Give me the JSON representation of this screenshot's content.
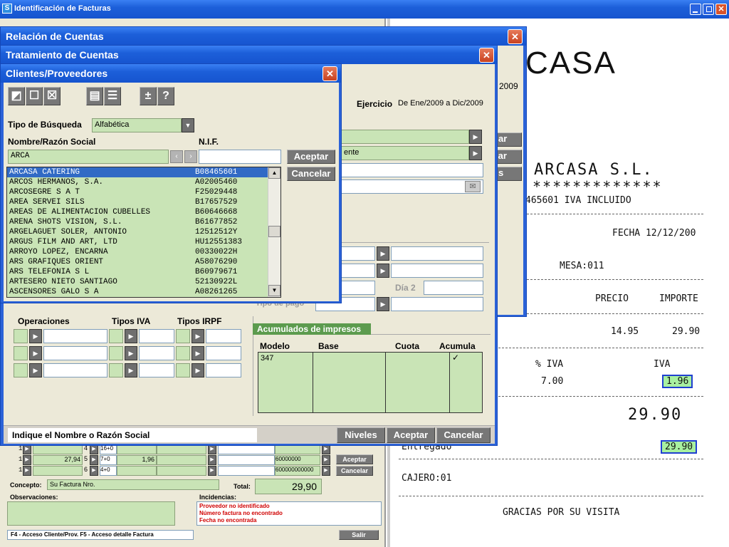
{
  "app": {
    "title": "Identificación de Facturas",
    "icon_letter": "S"
  },
  "dialogs": {
    "relacion": {
      "title": "Relación de Cuentas",
      "btn1": "ar",
      "btn2": "lar",
      "btn3": "s",
      "date_frag": "2009"
    },
    "tratamiento": {
      "title": "Tratamiento de Cuentas",
      "ejercicio_label": "Ejercicio",
      "ejercicio_value": "De Ene/2009 a Dic/2009",
      "field_frag": "ente",
      "dia2_label": "Día 2",
      "tipo_pago_label": "Tipo de pago",
      "operaciones": "Operaciones",
      "tipos_iva": "Tipos IVA",
      "tipos_irpf": "Tipos IRPF",
      "acumulados_tab": "Acumulados de impresos",
      "acum_headers": [
        "Modelo",
        "Base",
        "Cuota",
        "Acumula"
      ],
      "acum_row": {
        "modelo": "347",
        "base": "",
        "cuota": "",
        "acumula": "✓"
      },
      "status": "Indique el Nombre o Razón Social",
      "niveles": "Niveles",
      "aceptar": "Aceptar",
      "cancelar": "Cancelar"
    },
    "clientes": {
      "title": "Clientes/Proveedores",
      "tipo_busqueda_label": "Tipo de Búsqueda",
      "tipo_busqueda_value": "Alfabética",
      "nombre_label": "Nombre/Razón Social",
      "nif_label": "N.I.F.",
      "search_value": "ARCA",
      "aceptar": "Aceptar",
      "cancelar": "Cancelar",
      "items": [
        {
          "name": "ARCASA CATERING",
          "nif": "B08465601"
        },
        {
          "name": "ARCOS HERMANOS, S.A.",
          "nif": "A02005460"
        },
        {
          "name": "ARCOSEGRE S A T",
          "nif": "F25029448"
        },
        {
          "name": "AREA SERVEI SILS",
          "nif": "B17657529"
        },
        {
          "name": "AREAS DE ALIMENTACION CUBELLES",
          "nif": "B60646668"
        },
        {
          "name": "ARENA SHOTS VISION, S.L.",
          "nif": "B61677852"
        },
        {
          "name": "ARGELAGUET SOLER, ANTONIO",
          "nif": "12512512Y"
        },
        {
          "name": "ARGUS FILM AND ART, LTD",
          "nif": "HU12551383"
        },
        {
          "name": "ARROYO LOPEZ, ENCARNA",
          "nif": "00330022H"
        },
        {
          "name": "ARS GRAFIQUES ORIENT",
          "nif": "A58076290"
        },
        {
          "name": "ARS TELEFONIA S L",
          "nif": "B60979671"
        },
        {
          "name": "ARTESERO NIETO SANTIAGO",
          "nif": "52130922L"
        },
        {
          "name": "ASCENSORES GALO S A",
          "nif": "A08261265"
        }
      ]
    }
  },
  "main": {
    "rows": [
      {
        "c1": "1",
        "c2": "",
        "c3": "4",
        "c4": "16+0",
        "c5": "",
        "c6": ""
      },
      {
        "c1": "1",
        "c2": "27,94",
        "c3": "5",
        "c4": "7+0",
        "c5": "1,96",
        "c6": "60000000"
      },
      {
        "c1": "1",
        "c2": "",
        "c3": "6",
        "c4": "4+0",
        "c5": "",
        "c6": "600000000000"
      }
    ],
    "aceptar": "Aceptar",
    "cancelar": "Cancelar",
    "concepto_label": "Concepto:",
    "concepto_value": "Su Factura Nro.",
    "total_label": "Total:",
    "total_value": "29,90",
    "observaciones_label": "Observaciones:",
    "incidencias_label": "Incidencias:",
    "incidencias": [
      "Proveedor no identificado",
      "Número factura no encontrado",
      "Fecha no encontrada"
    ],
    "footer_hint": "F4 - Acceso Cliente/Prov. F5 - Acceso detalle Factura",
    "salir": "Salir"
  },
  "receipt": {
    "logo": "CASA",
    "company": "ARCASA S.L.",
    "stars": "*************",
    "nif_line": "465601  IVA INCLUIDO",
    "fecha": "FECHA  12/12/200",
    "mesa": "MESA:011",
    "precio": "PRECIO",
    "importe": "IMPORTE",
    "precio_val": "14.95",
    "importe_val": "29.90",
    "pct_iva": "% IVA",
    "iva": "IVA",
    "pct_val": "7.00",
    "iva_val": "1.96",
    "total_big": "29.90",
    "entregado": "Entregado",
    "entregado_val": "29.90",
    "cajero": "CAJERO:01",
    "gracias": "GRACIAS POR SU VISITA"
  }
}
